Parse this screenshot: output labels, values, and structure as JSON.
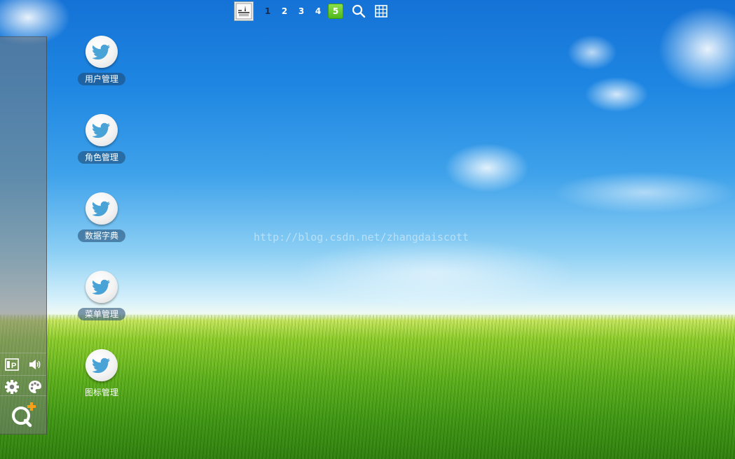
{
  "watermark": "http://blog.csdn.net/zhangdaiscott",
  "topbar": {
    "avatar_icon": "user-avatar-icon",
    "pages": [
      "1",
      "2",
      "3",
      "4",
      "5"
    ],
    "active_page": "5",
    "search_icon": "search-icon",
    "grid_icon": "grid-icon"
  },
  "dock": {
    "row1": [
      "widget-icon",
      "speaker-icon"
    ],
    "row2": [
      "gear-icon",
      "palette-icon"
    ],
    "qq_icon": "qq-plus-icon"
  },
  "apps": [
    {
      "label": "用户管理",
      "icon": "twitter-bird-icon"
    },
    {
      "label": "角色管理",
      "icon": "twitter-bird-icon"
    },
    {
      "label": "数据字典",
      "icon": "twitter-bird-icon"
    },
    {
      "label": "菜单管理",
      "icon": "twitter-bird-icon"
    },
    {
      "label": "图标管理",
      "icon": "twitter-bird-icon"
    }
  ],
  "colors": {
    "active_page": "#4fb81a",
    "label_bg": "#1e466e",
    "bird": "#48a4d4"
  }
}
